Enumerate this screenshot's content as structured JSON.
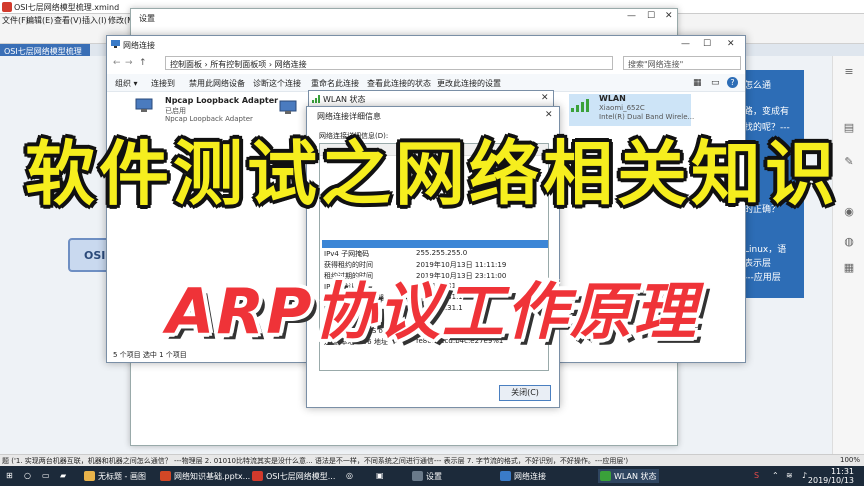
{
  "xmind": {
    "title": "OSI七层网络模型梳理.xmind",
    "menu": [
      "文件(F)",
      "编辑(E)",
      "查看(V)",
      "插入(I)",
      "修改(M)"
    ],
    "tab": "OSI七层网络模型梳理",
    "central_node": "OSI",
    "blue_panel": [
      "怎么通",
      "路，变成有",
      "找的呢？---",
      "的正确？",
      "Linux，语",
      "表示层",
      "---应用层"
    ],
    "status": "题 ('1. 实现两台机器互联，机器和机器之间怎么通信？ ---物理层 2. 01010比特流其实是没什么意... 语法是不一样，不同系统之间进行通信--- 表示层 7. 字节流的格式，不好识别，不好操作。---应用层')",
    "zoom": "100%"
  },
  "settings": {
    "title": "设置"
  },
  "network_window": {
    "title": "网络连接",
    "breadcrumb": "控制面板  ›  所有控制面板项  ›  网络连接",
    "search_placeholder": "搜索\"网络连接\"",
    "commands": [
      "组织 ▾",
      "连接到",
      "禁用此网络设备",
      "诊断这个连接",
      "重命名此连接",
      "查看此连接的状态",
      "更改此连接的设置"
    ],
    "adapters": [
      {
        "name": "Npcap Loopback Adapter",
        "status": "已启用",
        "device": "Npcap Loopback Adapter"
      },
      {
        "name": "WLAN",
        "status": "Xiaomi_652C",
        "device": "Intel(R) Dual Band Wirele..."
      }
    ],
    "status_bar": "5 个项目      选中 1 个项目"
  },
  "wlan_status": {
    "title": "WLAN 状态"
  },
  "details_dialog": {
    "title": "网络连接详细信息",
    "label": "网络连接详细信息(D):",
    "rows": [
      {
        "key": "IPv4 子网掩码",
        "value": "255.255.255.0"
      },
      {
        "key": "获得租约的时间",
        "value": "2019年10月13日 11:11:19"
      },
      {
        "key": "租约过期的时间",
        "value": "2019年10月13日 23:11:00"
      },
      {
        "key": "IPv4 默认网关",
        "value": "192.168.31.1"
      },
      {
        "key": "IPv4 DHCP 服务器",
        "value": "192.168.31.1"
      },
      {
        "key": "IPv4 DNS 服务器",
        "value": "192.168.31.1"
      },
      {
        "key": "IPv4 WINS 服务器",
        "value": ""
      },
      {
        "key": "已启用 NetBIOS over",
        "value": ""
      },
      {
        "key": "连接-本地 IPv6 地址",
        "value": "fe80::cecd:b4c:e27e9%1"
      }
    ],
    "close_label": "关闭(C)"
  },
  "overlay": {
    "headline": "软件测试之网络相关知识",
    "subheadline": "ARP协议工作原理"
  },
  "taskbar": {
    "items": [
      "无标题 - 画图",
      "网络知识基础.pptx...",
      "OSI七层网络模型...",
      "设置",
      "网络连接",
      "WLAN 状态"
    ],
    "time": "11:31",
    "date": "2019/10/13"
  }
}
